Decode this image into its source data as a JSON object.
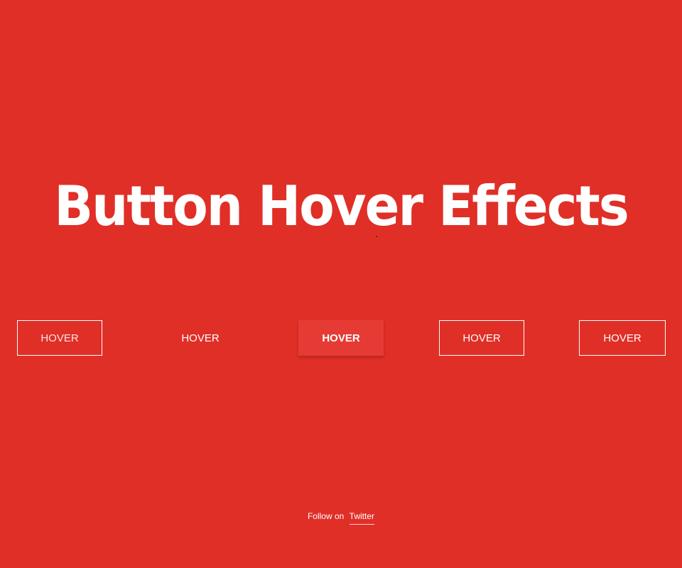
{
  "page": {
    "title": "Button Hover Effects"
  },
  "buttons": [
    {
      "label": "HOVER"
    },
    {
      "label": "HOVER"
    },
    {
      "label": "HOVER"
    },
    {
      "label": "HOVER"
    },
    {
      "label": "HOVER"
    }
  ],
  "footer": {
    "prefix": "Follow on",
    "link_label": "Twitter"
  },
  "colors": {
    "background": "#e02f27",
    "text": "#ffffff",
    "button_fill": "#e53b34"
  }
}
